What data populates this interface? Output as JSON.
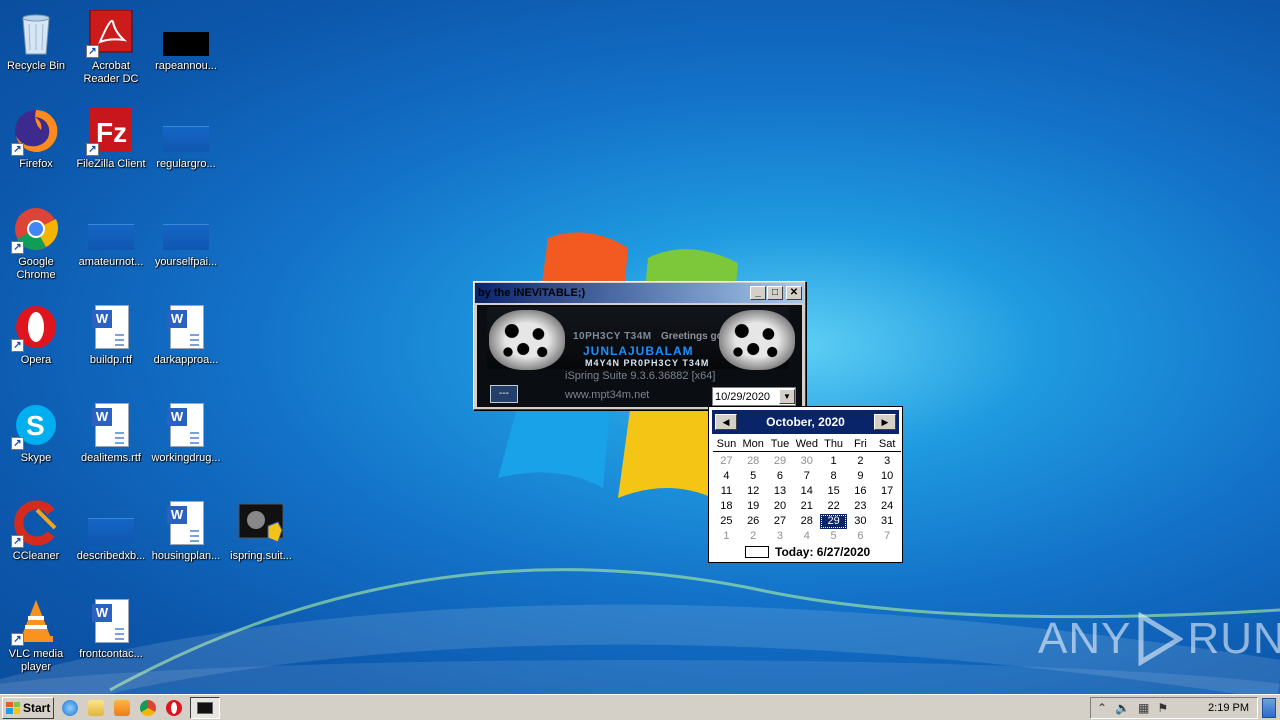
{
  "desktop": {
    "icons": [
      {
        "label": "Recycle Bin"
      },
      {
        "label": "Acrobat Reader DC"
      },
      {
        "label": "rapeannou..."
      },
      {
        "label": "Firefox"
      },
      {
        "label": "FileZilla Client"
      },
      {
        "label": "regulargro..."
      },
      {
        "label": "Google Chrome"
      },
      {
        "label": "amateurnot..."
      },
      {
        "label": "yourselfpai..."
      },
      {
        "label": "Opera"
      },
      {
        "label": "buildp.rtf"
      },
      {
        "label": "darkapproa..."
      },
      {
        "label": "Skype"
      },
      {
        "label": "dealitems.rtf"
      },
      {
        "label": "workingdrug..."
      },
      {
        "label": "CCleaner"
      },
      {
        "label": "describedxb..."
      },
      {
        "label": "housingplan..."
      },
      {
        "label": "ispring.suit..."
      },
      {
        "label": "VLC media player"
      },
      {
        "label": "frontcontac..."
      }
    ]
  },
  "app_window": {
    "title": "by the iNEViTABLE;)",
    "banner_line1": "10PH3CY T34M",
    "banner_line2": "Greetings go",
    "banner_line3": "JUNLAJUBALAM",
    "banner_line4": "M4Y4N PR0PH3CY T34M",
    "version": "iSpring Suite 9.3.6.36882 [x64]",
    "url": "www.mpt34m.net",
    "button_label": "---",
    "date_value": "10/29/2020"
  },
  "calendar": {
    "month_label": "October, 2020",
    "weekdays": [
      "Sun",
      "Mon",
      "Tue",
      "Wed",
      "Thu",
      "Fri",
      "Sat"
    ],
    "weeks": [
      [
        "27",
        "28",
        "29",
        "30",
        "1",
        "2",
        "3"
      ],
      [
        "4",
        "5",
        "6",
        "7",
        "8",
        "9",
        "10"
      ],
      [
        "11",
        "12",
        "13",
        "14",
        "15",
        "16",
        "17"
      ],
      [
        "18",
        "19",
        "20",
        "21",
        "22",
        "23",
        "24"
      ],
      [
        "25",
        "26",
        "27",
        "28",
        "29",
        "30",
        "31"
      ],
      [
        "1",
        "2",
        "3",
        "4",
        "5",
        "6",
        "7"
      ]
    ],
    "selected_day": "29",
    "today_label": "Today: 6/27/2020"
  },
  "watermark": {
    "text": "ANY",
    "text2": "RUN"
  },
  "taskbar": {
    "start_label": "Start",
    "clock": "2:19 PM"
  },
  "colors": {
    "titlebar": "#0a246a",
    "desktop": "#1372c8"
  }
}
